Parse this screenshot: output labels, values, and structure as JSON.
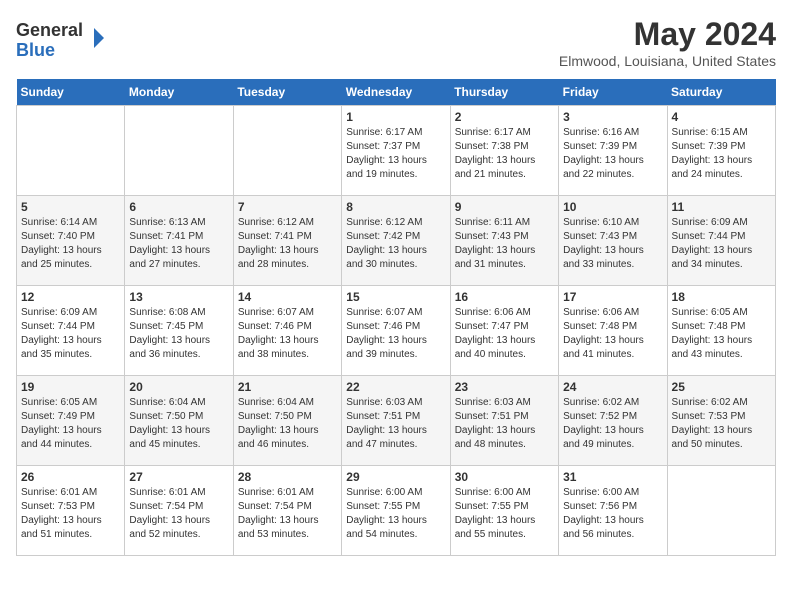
{
  "header": {
    "logo_general": "General",
    "logo_blue": "Blue",
    "title": "May 2024",
    "subtitle": "Elmwood, Louisiana, United States"
  },
  "calendar": {
    "weekdays": [
      "Sunday",
      "Monday",
      "Tuesday",
      "Wednesday",
      "Thursday",
      "Friday",
      "Saturday"
    ],
    "weeks": [
      [
        {
          "day": "",
          "info": ""
        },
        {
          "day": "",
          "info": ""
        },
        {
          "day": "",
          "info": ""
        },
        {
          "day": "1",
          "info": "Sunrise: 6:17 AM\nSunset: 7:37 PM\nDaylight: 13 hours\nand 19 minutes."
        },
        {
          "day": "2",
          "info": "Sunrise: 6:17 AM\nSunset: 7:38 PM\nDaylight: 13 hours\nand 21 minutes."
        },
        {
          "day": "3",
          "info": "Sunrise: 6:16 AM\nSunset: 7:39 PM\nDaylight: 13 hours\nand 22 minutes."
        },
        {
          "day": "4",
          "info": "Sunrise: 6:15 AM\nSunset: 7:39 PM\nDaylight: 13 hours\nand 24 minutes."
        }
      ],
      [
        {
          "day": "5",
          "info": "Sunrise: 6:14 AM\nSunset: 7:40 PM\nDaylight: 13 hours\nand 25 minutes."
        },
        {
          "day": "6",
          "info": "Sunrise: 6:13 AM\nSunset: 7:41 PM\nDaylight: 13 hours\nand 27 minutes."
        },
        {
          "day": "7",
          "info": "Sunrise: 6:12 AM\nSunset: 7:41 PM\nDaylight: 13 hours\nand 28 minutes."
        },
        {
          "day": "8",
          "info": "Sunrise: 6:12 AM\nSunset: 7:42 PM\nDaylight: 13 hours\nand 30 minutes."
        },
        {
          "day": "9",
          "info": "Sunrise: 6:11 AM\nSunset: 7:43 PM\nDaylight: 13 hours\nand 31 minutes."
        },
        {
          "day": "10",
          "info": "Sunrise: 6:10 AM\nSunset: 7:43 PM\nDaylight: 13 hours\nand 33 minutes."
        },
        {
          "day": "11",
          "info": "Sunrise: 6:09 AM\nSunset: 7:44 PM\nDaylight: 13 hours\nand 34 minutes."
        }
      ],
      [
        {
          "day": "12",
          "info": "Sunrise: 6:09 AM\nSunset: 7:44 PM\nDaylight: 13 hours\nand 35 minutes."
        },
        {
          "day": "13",
          "info": "Sunrise: 6:08 AM\nSunset: 7:45 PM\nDaylight: 13 hours\nand 36 minutes."
        },
        {
          "day": "14",
          "info": "Sunrise: 6:07 AM\nSunset: 7:46 PM\nDaylight: 13 hours\nand 38 minutes."
        },
        {
          "day": "15",
          "info": "Sunrise: 6:07 AM\nSunset: 7:46 PM\nDaylight: 13 hours\nand 39 minutes."
        },
        {
          "day": "16",
          "info": "Sunrise: 6:06 AM\nSunset: 7:47 PM\nDaylight: 13 hours\nand 40 minutes."
        },
        {
          "day": "17",
          "info": "Sunrise: 6:06 AM\nSunset: 7:48 PM\nDaylight: 13 hours\nand 41 minutes."
        },
        {
          "day": "18",
          "info": "Sunrise: 6:05 AM\nSunset: 7:48 PM\nDaylight: 13 hours\nand 43 minutes."
        }
      ],
      [
        {
          "day": "19",
          "info": "Sunrise: 6:05 AM\nSunset: 7:49 PM\nDaylight: 13 hours\nand 44 minutes."
        },
        {
          "day": "20",
          "info": "Sunrise: 6:04 AM\nSunset: 7:50 PM\nDaylight: 13 hours\nand 45 minutes."
        },
        {
          "day": "21",
          "info": "Sunrise: 6:04 AM\nSunset: 7:50 PM\nDaylight: 13 hours\nand 46 minutes."
        },
        {
          "day": "22",
          "info": "Sunrise: 6:03 AM\nSunset: 7:51 PM\nDaylight: 13 hours\nand 47 minutes."
        },
        {
          "day": "23",
          "info": "Sunrise: 6:03 AM\nSunset: 7:51 PM\nDaylight: 13 hours\nand 48 minutes."
        },
        {
          "day": "24",
          "info": "Sunrise: 6:02 AM\nSunset: 7:52 PM\nDaylight: 13 hours\nand 49 minutes."
        },
        {
          "day": "25",
          "info": "Sunrise: 6:02 AM\nSunset: 7:53 PM\nDaylight: 13 hours\nand 50 minutes."
        }
      ],
      [
        {
          "day": "26",
          "info": "Sunrise: 6:01 AM\nSunset: 7:53 PM\nDaylight: 13 hours\nand 51 minutes."
        },
        {
          "day": "27",
          "info": "Sunrise: 6:01 AM\nSunset: 7:54 PM\nDaylight: 13 hours\nand 52 minutes."
        },
        {
          "day": "28",
          "info": "Sunrise: 6:01 AM\nSunset: 7:54 PM\nDaylight: 13 hours\nand 53 minutes."
        },
        {
          "day": "29",
          "info": "Sunrise: 6:00 AM\nSunset: 7:55 PM\nDaylight: 13 hours\nand 54 minutes."
        },
        {
          "day": "30",
          "info": "Sunrise: 6:00 AM\nSunset: 7:55 PM\nDaylight: 13 hours\nand 55 minutes."
        },
        {
          "day": "31",
          "info": "Sunrise: 6:00 AM\nSunset: 7:56 PM\nDaylight: 13 hours\nand 56 minutes."
        },
        {
          "day": "",
          "info": ""
        }
      ]
    ]
  }
}
